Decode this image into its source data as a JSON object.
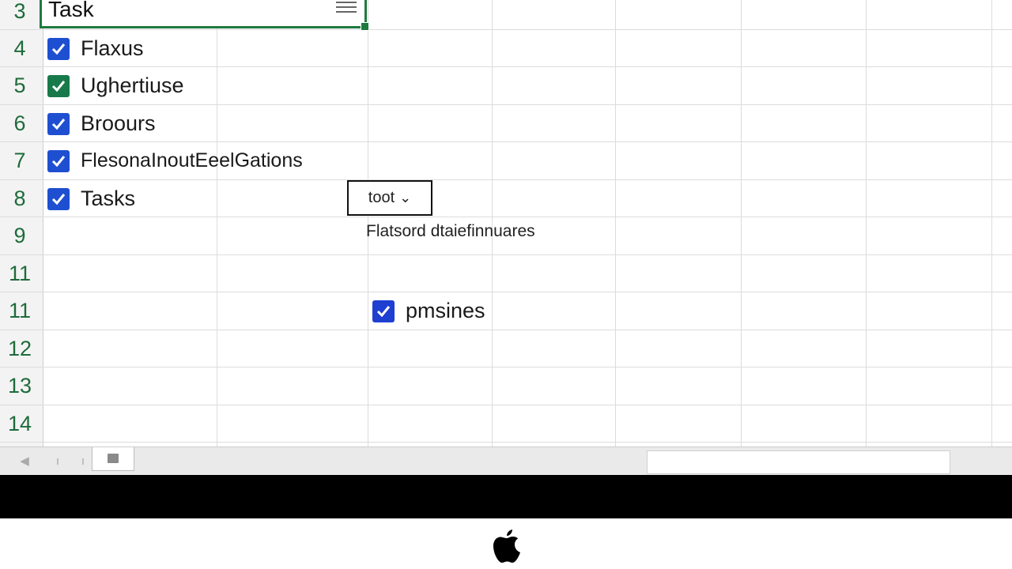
{
  "grid": {
    "row_numbers": [
      "3",
      "4",
      "5",
      "6",
      "7",
      "8",
      "9",
      "11",
      "11",
      "12",
      "13",
      "14"
    ],
    "header_cell": {
      "text": "Task",
      "filter_icon": "filter-lines-icon"
    },
    "tasks": [
      {
        "label": "Flaxus",
        "checked": true,
        "color": "#1f4fd1"
      },
      {
        "label": "Ughertiuse",
        "checked": true,
        "color": "#187a4a"
      },
      {
        "label": "Broours",
        "checked": true,
        "color": "#1f4fd1"
      },
      {
        "label": "FlesonaInoutEeelGations",
        "checked": true,
        "color": "#1f4fd1"
      },
      {
        "label": "Tasks",
        "checked": true,
        "color": "#1f4fd1"
      }
    ],
    "dropdown": {
      "value": "toot",
      "icon": "chevron-down-icon"
    },
    "note": "Flatsord dtaiefinnuares",
    "option": {
      "label": "pmsines",
      "checked": true,
      "color": "#1f3fd1"
    }
  },
  "tabbar": {
    "nav_prev_icon": "triangle-left-icon",
    "sheet_icon": "sheet-icon"
  },
  "device": {
    "logo_icon": "apple-logo-icon"
  }
}
